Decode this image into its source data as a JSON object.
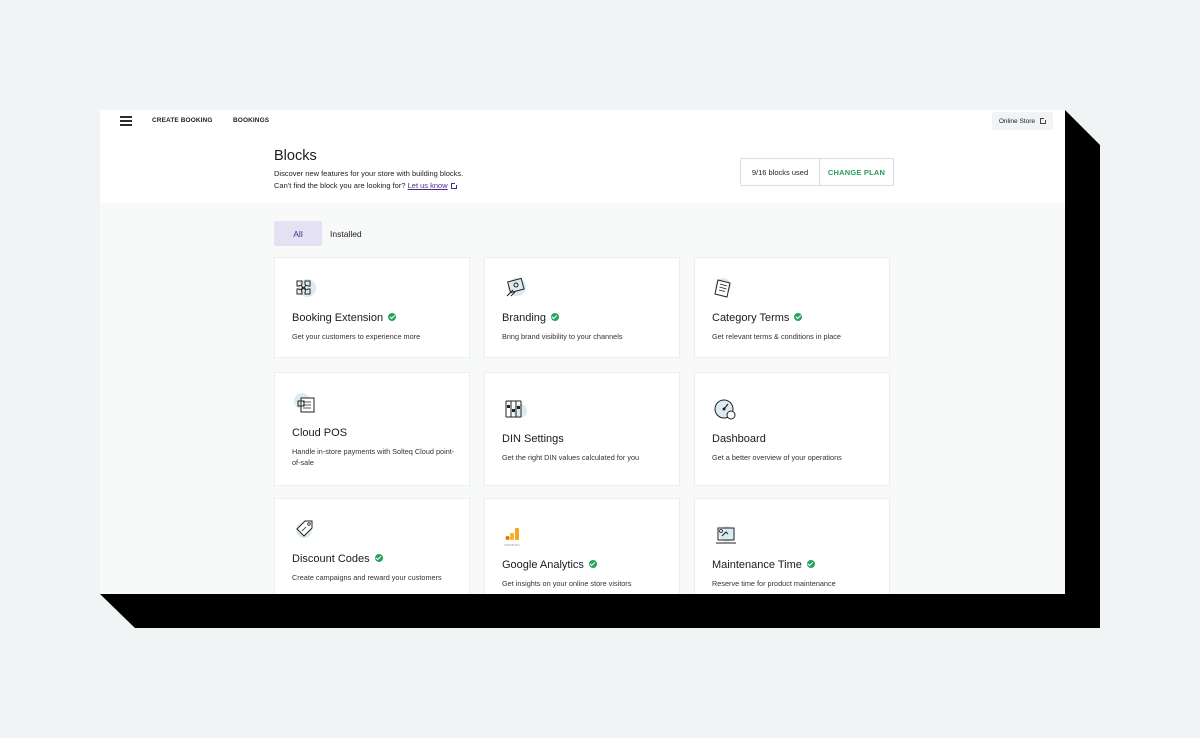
{
  "topbar": {
    "menu_icon": "hamburger-icon",
    "nav": [
      "CREATE BOOKING",
      "BOOKINGS"
    ],
    "online_store_label": "Online Store",
    "external_icon": "external-link-icon"
  },
  "header": {
    "title": "Blocks",
    "subtitle_line1": "Discover new features for your store with building blocks.",
    "subtitle_line2_prefix": "Can't find the block you are looking for?",
    "link_label": "Let us know",
    "blocks_used": "9/16 blocks used",
    "change_plan_label": "CHANGE PLAN"
  },
  "tabs": {
    "all": "All",
    "installed": "Installed"
  },
  "colors": {
    "accent_purple": "#4b2b8a",
    "tab_bg": "#e4e1f3",
    "check_green": "#27a35a",
    "change_plan_green": "#2e9a59"
  },
  "cards": [
    {
      "title": "Booking Extension",
      "installed": true,
      "desc": "Get your customers to experience more",
      "icon": "puzzle-icon"
    },
    {
      "title": "Branding",
      "installed": true,
      "desc": "Bring brand visibility to your channels",
      "icon": "palette-icon"
    },
    {
      "title": "Category Terms",
      "installed": true,
      "desc": "Get relevant terms & conditions in place",
      "icon": "document-icon"
    },
    {
      "title": "Cloud POS",
      "installed": false,
      "desc": "Handle in-store payments with Solteq Cloud point-of-sale",
      "icon": "pos-terminal-icon"
    },
    {
      "title": "DIN Settings",
      "installed": false,
      "desc": "Get the right DIN values calculated for you",
      "icon": "ski-binding-icon"
    },
    {
      "title": "Dashboard",
      "installed": false,
      "desc": "Get a better overview of your operations",
      "icon": "speedometer-icon"
    },
    {
      "title": "Discount Codes",
      "installed": true,
      "desc": "Create campaigns and reward your customers",
      "icon": "discount-tag-icon"
    },
    {
      "title": "Google Analytics",
      "installed": true,
      "desc": "Get insights on your online store visitors",
      "icon": "google-analytics-icon",
      "icon_caption": "Google Analytics"
    },
    {
      "title": "Maintenance Time",
      "installed": true,
      "desc": "Reserve time for product maintenance",
      "icon": "maintenance-icon"
    }
  ]
}
